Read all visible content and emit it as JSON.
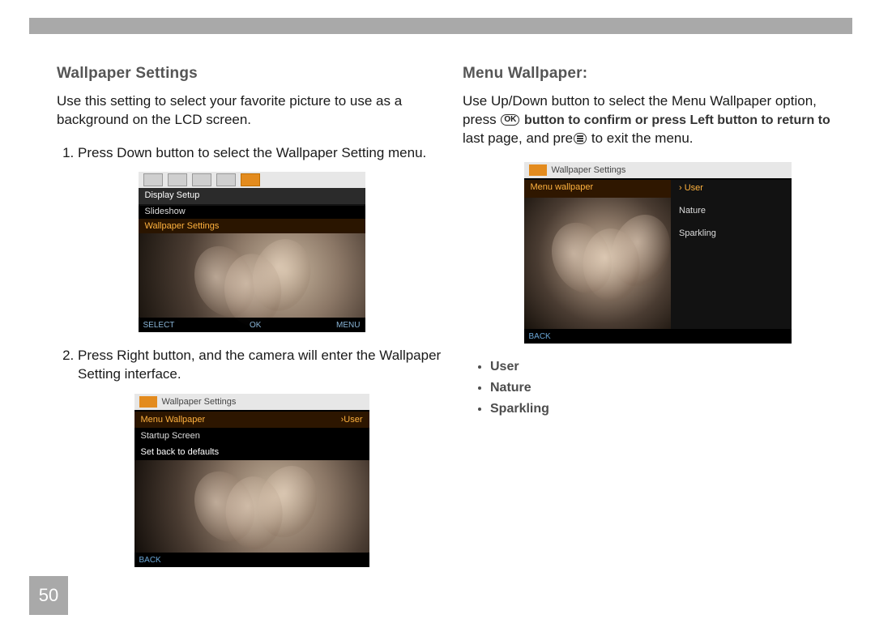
{
  "page_number": "50",
  "left": {
    "heading": "Wallpaper Settings",
    "intro": "Use this setting to select your favorite picture to use as a background on the LCD screen.",
    "step1": "Press Down button to select the Wallpaper Setting menu.",
    "step2": "Press Right button, and the camera will enter the Wallpaper Setting interface.",
    "shot1": {
      "header": "Display Setup",
      "row1": "Slideshow",
      "row2": "Wallpaper Settings",
      "foot_select": "SELECT",
      "foot_ok": "OK",
      "foot_menu": "MENU"
    },
    "shot2": {
      "title": "Wallpaper Settings",
      "row1_label": "Menu Wallpaper",
      "row1_value": "›User",
      "row2": "Startup Screen",
      "row3": "Set back to defaults",
      "foot_back": "BACK"
    }
  },
  "right": {
    "heading": "Menu Wallpaper:",
    "para_a": "Use Up/Down button to select the Menu Wallpaper option, press",
    "para_b": "button to confirm or press Left button to return to",
    "para_c": "last page, and pre",
    "para_d": "to exit the menu.",
    "ok_label": "OK",
    "shot3": {
      "title": "Wallpaper Settings",
      "left_label": "Menu wallpaper",
      "opt1": "User",
      "opt2": "Nature",
      "opt3": "Sparkling",
      "foot_back": "BACK"
    },
    "options": [
      "User",
      "Nature",
      "Sparkling"
    ]
  }
}
